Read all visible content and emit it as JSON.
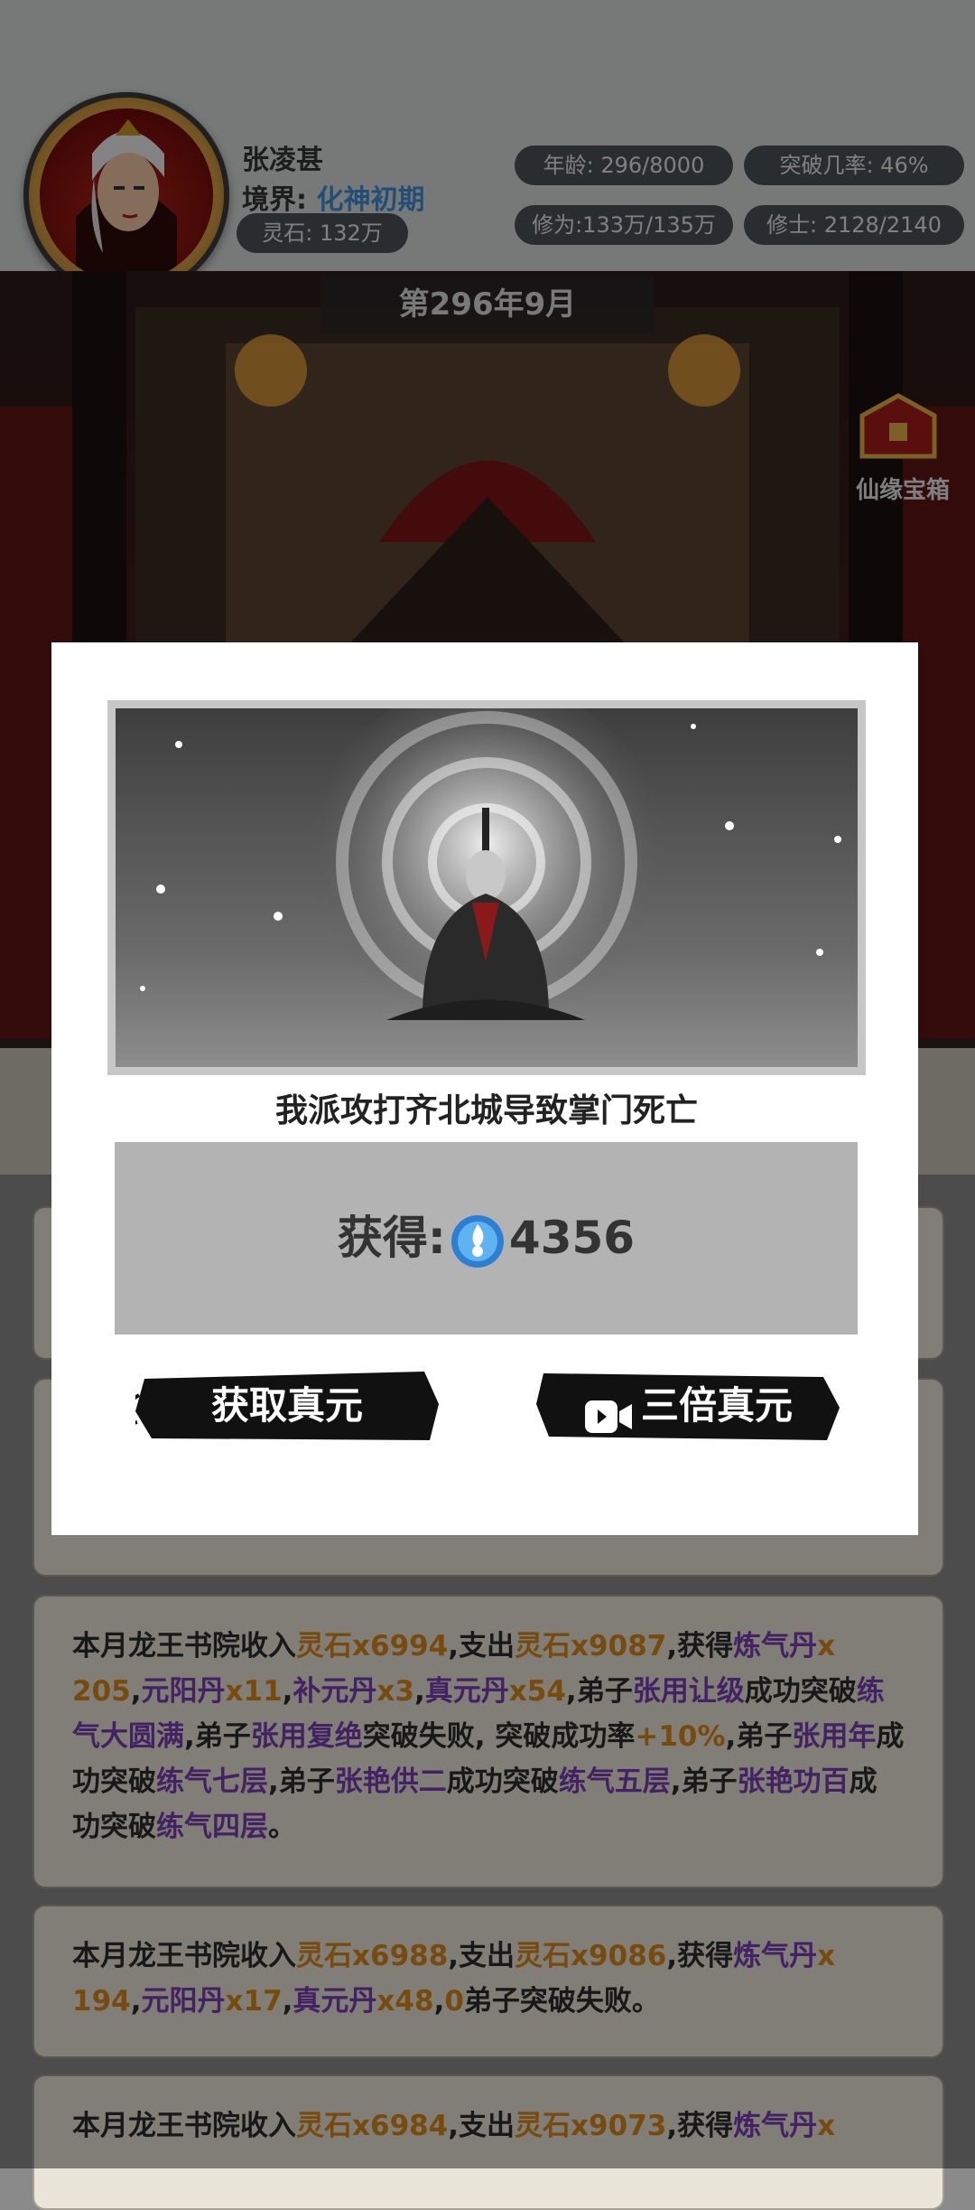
{
  "header": {
    "player_name": "张凌甚",
    "realm_label": "境界:",
    "realm_value": "化神初期",
    "spirit_stone": "灵石: 132万",
    "age": "年龄: 296/8000",
    "breakthrough": "突破几率: 46%",
    "cultivation": "修为:133万/135万",
    "disciples": "修士: 2128/2140"
  },
  "scene": {
    "date_banner": "第296年9月",
    "treasure_chest_label": "仙缘宝箱"
  },
  "modal": {
    "event_text": "我派攻打齐北城导致掌门死亡",
    "reward_prefix": "获得:",
    "reward_amount": "4356",
    "reward_icon": "true-essence-orb-icon",
    "button_claim": "获取真元",
    "button_triple": "三倍真元"
  },
  "log": {
    "card1": {
      "t1": "本月龙王书院收入",
      "t2": "灵石x6994",
      "t3": ",支出",
      "t4": "灵石x9087",
      "t5": ",获得",
      "t6": "炼气丹",
      "t7": "x",
      "t8": "205",
      "t9": ",",
      "t10": "元阳丹",
      "t11": "x11",
      "t12": ",",
      "t13": "补元丹",
      "t14": "x3",
      "t15": ",",
      "t16": "真元丹",
      "t17": "x54",
      "t18": ",弟子",
      "t19": "张用让级",
      "t20": "成功突破",
      "t21": "练气大圆满",
      "t22": ",弟子",
      "t23": "张用复绝",
      "t24": "突破失败, 突破成功率",
      "t25": "+10%",
      "t26": ",弟子",
      "t27": "张用年",
      "t28": "成功突破",
      "t29": "练气七层",
      "t30": ",弟子",
      "t31": "张艳供二",
      "t32": "成功突破",
      "t33": "练气五层",
      "t34": ",弟子",
      "t35": "张艳功百",
      "t36": "成功突破",
      "t37": "练气四层",
      "t38": "。"
    },
    "card2": {
      "t1": "本月龙王书院收入",
      "t2": "灵石x6988",
      "t3": ",支出",
      "t4": "灵石x9086",
      "t5": ",获得",
      "t6": "炼气丹",
      "t7": "x",
      "t8": "194",
      "t9": ",",
      "t10": "元阳丹",
      "t11": "x17",
      "t12": ",",
      "t13": "真元丹",
      "t14": "x48",
      "t15": ",",
      "t16": "0",
      "t17": "弟子突破失败。"
    },
    "card3": {
      "t1": "本月龙王书院收入",
      "t2": "灵石x6984",
      "t3": ",支出",
      "t4": "灵石x9073",
      "t5": ",获得",
      "t6": "炼气丹",
      "t7": "x"
    }
  },
  "colors": {
    "purple": "#7a3fb5",
    "orange": "#d9871b",
    "realm_blue": "#3f8fd6"
  }
}
